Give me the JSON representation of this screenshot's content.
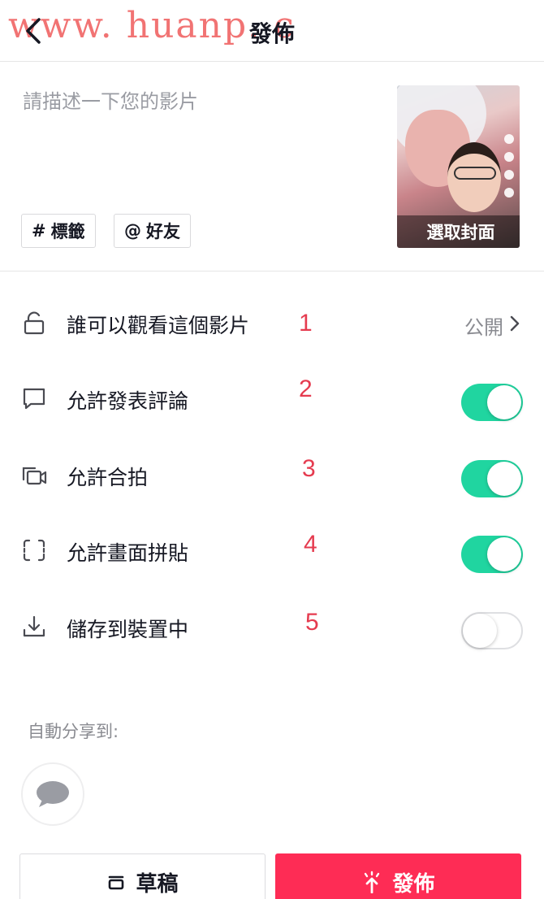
{
  "watermark": "www. huanp. c",
  "header": {
    "title": "發佈"
  },
  "description": {
    "placeholder": "請描述一下您的影片",
    "value": ""
  },
  "chips": {
    "hashtag_symbol": "#",
    "hashtag": "標籤",
    "mention_symbol": "@",
    "mention": "好友"
  },
  "cover": {
    "label": "選取封面"
  },
  "settings": [
    {
      "label": "誰可以觀看這個影片",
      "number": "1",
      "value": "公開",
      "icon": "lock-icon"
    },
    {
      "label": "允許發表評論",
      "number": "2",
      "toggle": true,
      "icon": "comment-icon"
    },
    {
      "label": "允許合拍",
      "number": "3",
      "toggle": true,
      "icon": "duet-icon"
    },
    {
      "label": "允許畫面拼貼",
      "number": "4",
      "toggle": true,
      "icon": "stitch-icon"
    },
    {
      "label": "儲存到裝置中",
      "number": "5",
      "toggle": false,
      "icon": "download-icon"
    }
  ],
  "share": {
    "title": "自動分享到:",
    "icon": "message-icon"
  },
  "buttons": {
    "draft": "草稿",
    "publish": "發佈"
  },
  "colors": {
    "toggle_on": "#20d5a0",
    "publish": "#fe2c55",
    "annotation": "#e53b4f"
  }
}
